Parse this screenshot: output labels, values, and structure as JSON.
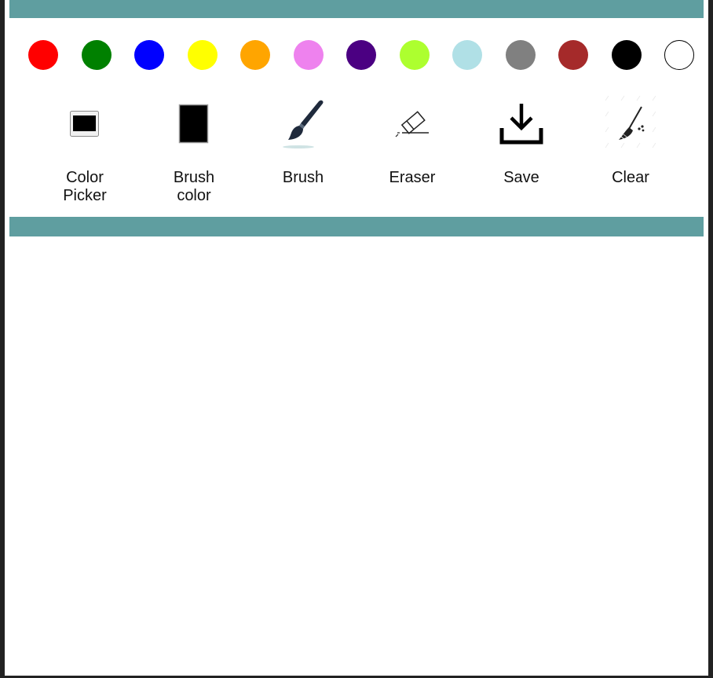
{
  "palette": [
    {
      "name": "red",
      "color": "#ff0000"
    },
    {
      "name": "green",
      "color": "#008000"
    },
    {
      "name": "blue",
      "color": "#0000ff"
    },
    {
      "name": "yellow",
      "color": "#ffff00"
    },
    {
      "name": "orange",
      "color": "#ffa500"
    },
    {
      "name": "violet",
      "color": "#ee82ee"
    },
    {
      "name": "indigo",
      "color": "#4b0082"
    },
    {
      "name": "greenyellow",
      "color": "#adff2f"
    },
    {
      "name": "powderblue",
      "color": "#b0e0e6"
    },
    {
      "name": "gray",
      "color": "#808080"
    },
    {
      "name": "brown",
      "color": "#a52a2a"
    },
    {
      "name": "black",
      "color": "#000000"
    },
    {
      "name": "white",
      "color": "#ffffff"
    }
  ],
  "tools": {
    "color_picker": {
      "label": "Color\nPicker",
      "icon": "color-picker-icon"
    },
    "brush_color": {
      "label": "Brush\ncolor",
      "icon": "brush-color-swatch-icon"
    },
    "brush": {
      "label": "Brush",
      "icon": "paintbrush-icon"
    },
    "eraser": {
      "label": "Eraser",
      "icon": "eraser-icon"
    },
    "save": {
      "label": "Save",
      "icon": "download-icon"
    },
    "clear": {
      "label": "Clear",
      "icon": "broom-icon"
    }
  },
  "colors": {
    "band": "#5f9ea0",
    "current_brush": "#000000"
  }
}
